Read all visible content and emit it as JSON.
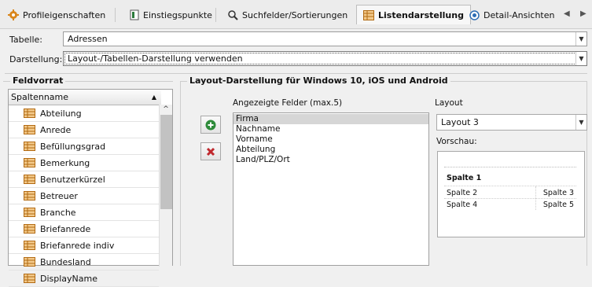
{
  "tabs": [
    {
      "label": "Profileigenschaften",
      "icon": "gear-icon"
    },
    {
      "label": "Einstiegspunkte",
      "icon": "bracket-icon"
    },
    {
      "label": "Suchfelder/Sortierungen",
      "icon": "search-icon"
    },
    {
      "label": "Listendarstellung",
      "icon": "table-icon",
      "active": true
    },
    {
      "label": "Detail-Ansichten",
      "icon": "eye-icon"
    }
  ],
  "table_label": "Tabelle:",
  "table_value": "Adressen",
  "display_label": "Darstellung:",
  "display_value": "Layout-/Tabellen-Darstellung verwenden",
  "field_pool": {
    "title": "Feldvorrat",
    "column_header": "Spaltenname",
    "items": [
      "Abteilung",
      "Anrede",
      "Befüllungsgrad",
      "Bemerkung",
      "Benutzerkürzel",
      "Betreuer",
      "Branche",
      "Briefanrede",
      "Briefanrede indiv",
      "Bundesland",
      "DisplayName"
    ]
  },
  "layout_group": {
    "title": "Layout-Darstellung für Windows 10, iOS und Android",
    "shown_fields_label": "Angezeigte Felder (max.5)",
    "shown_fields": [
      "Firma",
      "Nachname",
      "Vorname",
      "Abteilung",
      "Land/PLZ/Ort"
    ],
    "selected_field_index": 0,
    "layout_label": "Layout",
    "layout_value": "Layout 3",
    "preview_label": "Vorschau:",
    "preview": {
      "row1": "Spalte 1",
      "row2_left": "Spalte 2",
      "row2_right": "Spalte 3",
      "row3_left": "Spalte 4",
      "row3_right": "Spalte 5"
    }
  },
  "colors": {
    "add_green": "#2e8b3a",
    "remove_red": "#c0282d",
    "selection_bg": "#d6d6d6",
    "icon_orange": "#d9861c"
  }
}
